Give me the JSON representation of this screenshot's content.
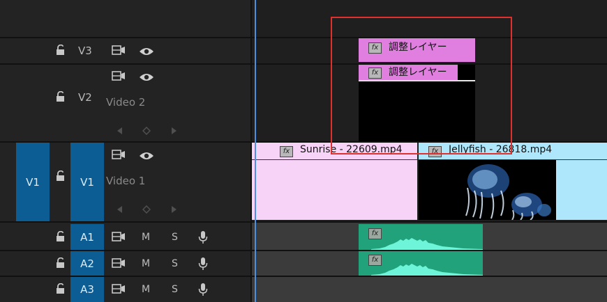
{
  "tracks": {
    "v3": {
      "label": "V3"
    },
    "v2": {
      "label": "V2",
      "name": "Video 2"
    },
    "v1": {
      "label": "V1",
      "source_label": "V1",
      "name": "Video 1"
    },
    "a1": {
      "label": "A1",
      "mute": "M",
      "solo": "S"
    },
    "a2": {
      "label": "A2",
      "mute": "M",
      "solo": "S"
    },
    "a3": {
      "label": "A3",
      "mute": "M",
      "solo": "S"
    }
  },
  "clips": {
    "adjustment_v3": {
      "title": "調整レイヤー",
      "fx": "fx",
      "color": "#e07fe0"
    },
    "adjustment_v2": {
      "title": "調整レイヤー",
      "fx": "fx",
      "color": "#e07fe0"
    },
    "sunrise": {
      "title": "Sunrise - 22609.mp4",
      "fx": "fx",
      "color": "#f8d3f8"
    },
    "jellyfish": {
      "title": "Jellyfish - 26818.mp4",
      "fx": "fx",
      "color": "#aee7fb"
    },
    "audio_a1": {
      "fx": "fx",
      "color": "#22a27a"
    },
    "audio_a2": {
      "fx": "fx",
      "color": "#22a27a"
    }
  },
  "colors": {
    "accent_blue": "#0d5d95",
    "playhead": "#4a90e2",
    "highlight_box": "#e0302e"
  },
  "icons": [
    "lock-icon",
    "film-sync-icon",
    "eye-icon",
    "microphone-icon",
    "prev-keyframe-icon",
    "add-keyframe-icon",
    "next-keyframe-icon"
  ]
}
